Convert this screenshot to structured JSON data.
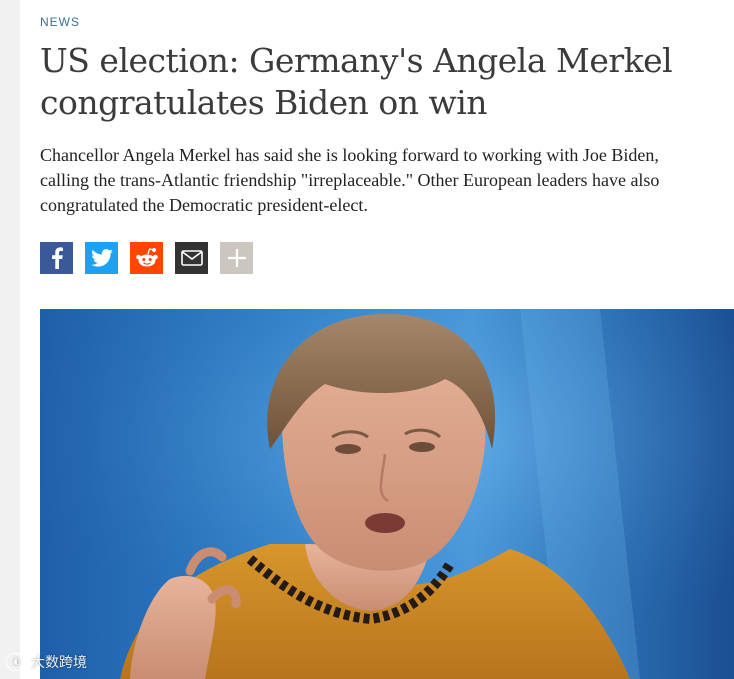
{
  "article": {
    "category": "NEWS",
    "headline": "US election: Germany's Angela Merkel congratulates Biden on win",
    "lede": "Chancellor Angela Merkel has said she is looking forward to working with Joe Biden, calling the trans-Atlantic friendship \"irreplaceable.\" Other European leaders have also congratulated the Democratic president-elect."
  },
  "share": {
    "buttons": [
      {
        "icon": "facebook-icon",
        "color": "#3b5998"
      },
      {
        "icon": "twitter-icon",
        "color": "#1da1f2"
      },
      {
        "icon": "reddit-icon",
        "color": "#ff4500"
      },
      {
        "icon": "email-icon",
        "color": "#333333"
      },
      {
        "icon": "plus-icon",
        "color": "#cbc7c0"
      }
    ]
  },
  "watermark": {
    "text": "大数跨境"
  },
  "colors": {
    "category": "#3a6f97",
    "headline": "#3b3b3b",
    "background": "#ffffff"
  }
}
